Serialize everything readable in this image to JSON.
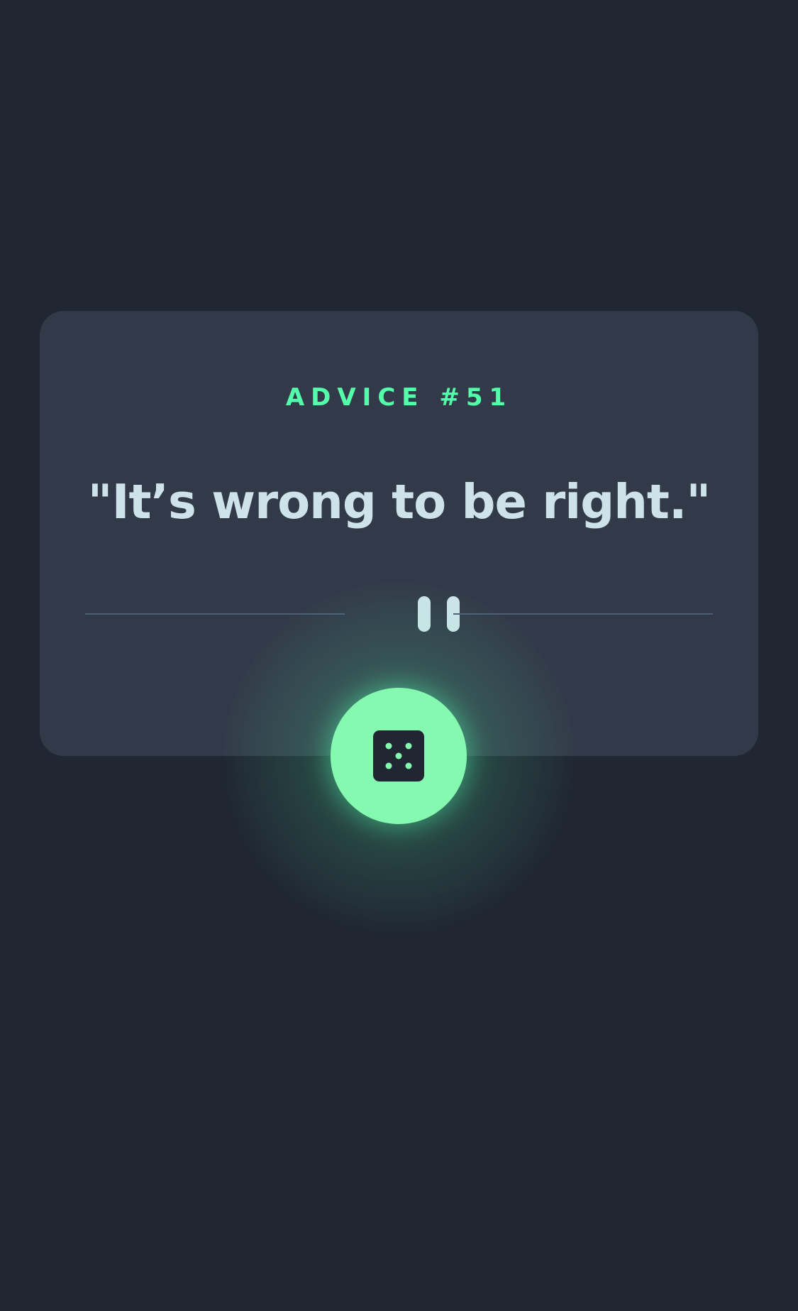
{
  "card": {
    "heading": "ADVICE #51",
    "quote": "\"It’s wrong to be right.\""
  },
  "divider": {
    "icon": "pause-icon"
  },
  "dice_button": {
    "icon": "dice-icon"
  },
  "colors": {
    "background": "#202632",
    "card": "#323A49",
    "accent": "#53FFAB",
    "button": "#86F9B0",
    "quote_text": "#CEE3E9",
    "divider_line": "#4F5D74"
  }
}
